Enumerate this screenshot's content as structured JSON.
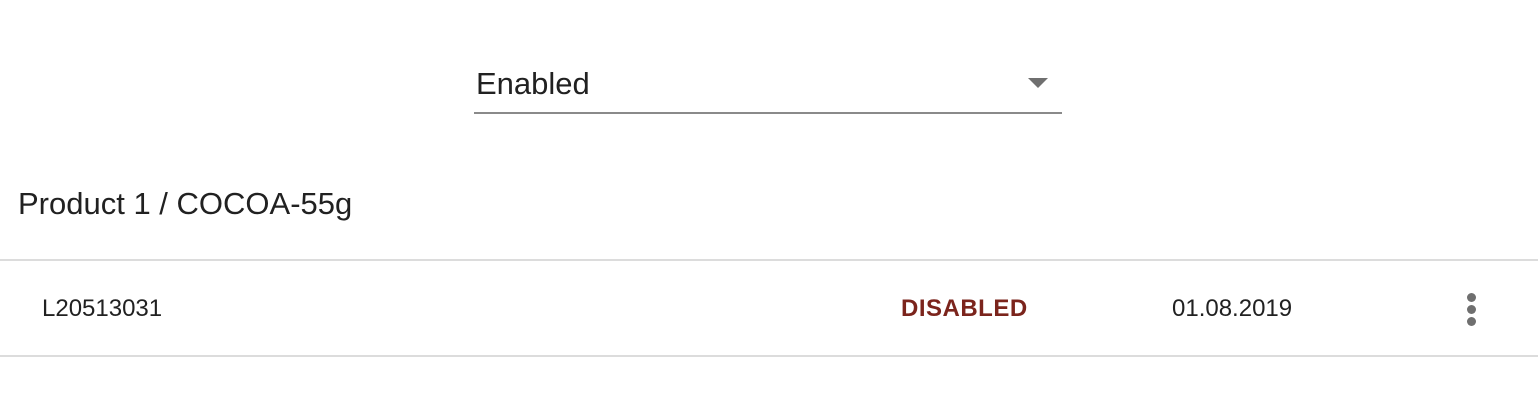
{
  "filter": {
    "selected_value": "Enabled"
  },
  "product": {
    "title": "Product 1 / COCOA-55g"
  },
  "rows": [
    {
      "code": "L20513031",
      "status": "DISABLED",
      "date": "01.08.2019",
      "actions_icon": "more-vert-icon"
    }
  ],
  "colors": {
    "status_disabled": "#7b241c",
    "divider": "#dcdcdc",
    "underline": "#8a8a8a"
  }
}
